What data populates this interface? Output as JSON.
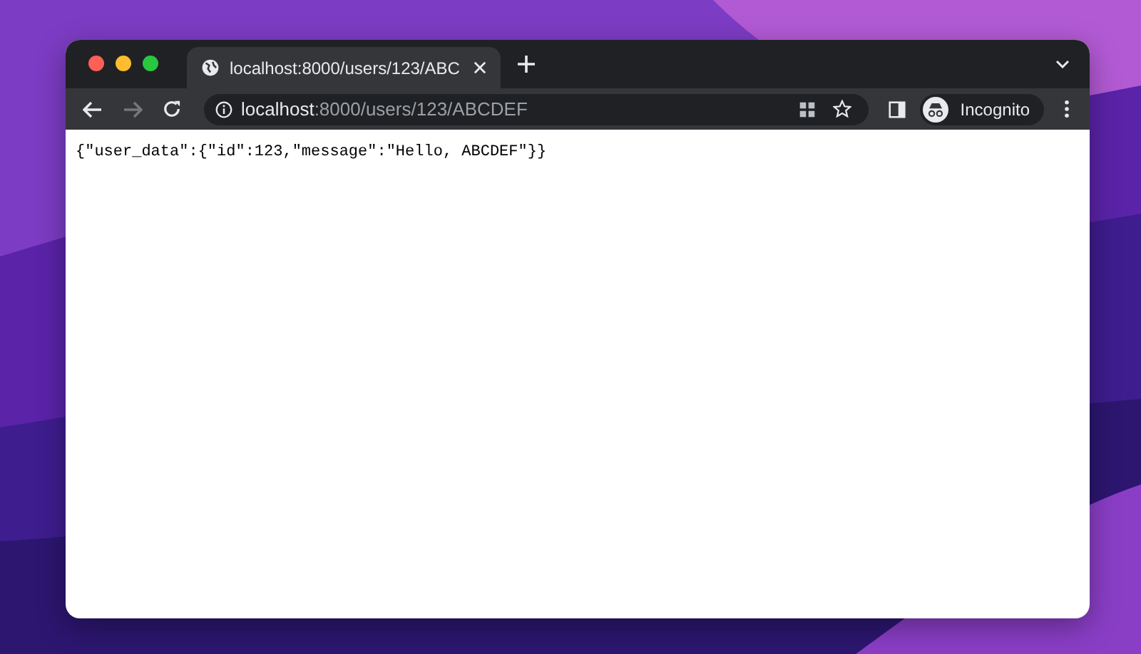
{
  "tabs": [
    {
      "title": "localhost:8000/users/123/ABC",
      "selected": true
    }
  ],
  "address": {
    "host": "localhost",
    "path": ":8000/users/123/ABCDEF"
  },
  "profile": {
    "label": "Incognito"
  },
  "page": {
    "body": "{\"user_data\":{\"id\":123,\"message\":\"Hello, ABCDEF\"}}"
  }
}
